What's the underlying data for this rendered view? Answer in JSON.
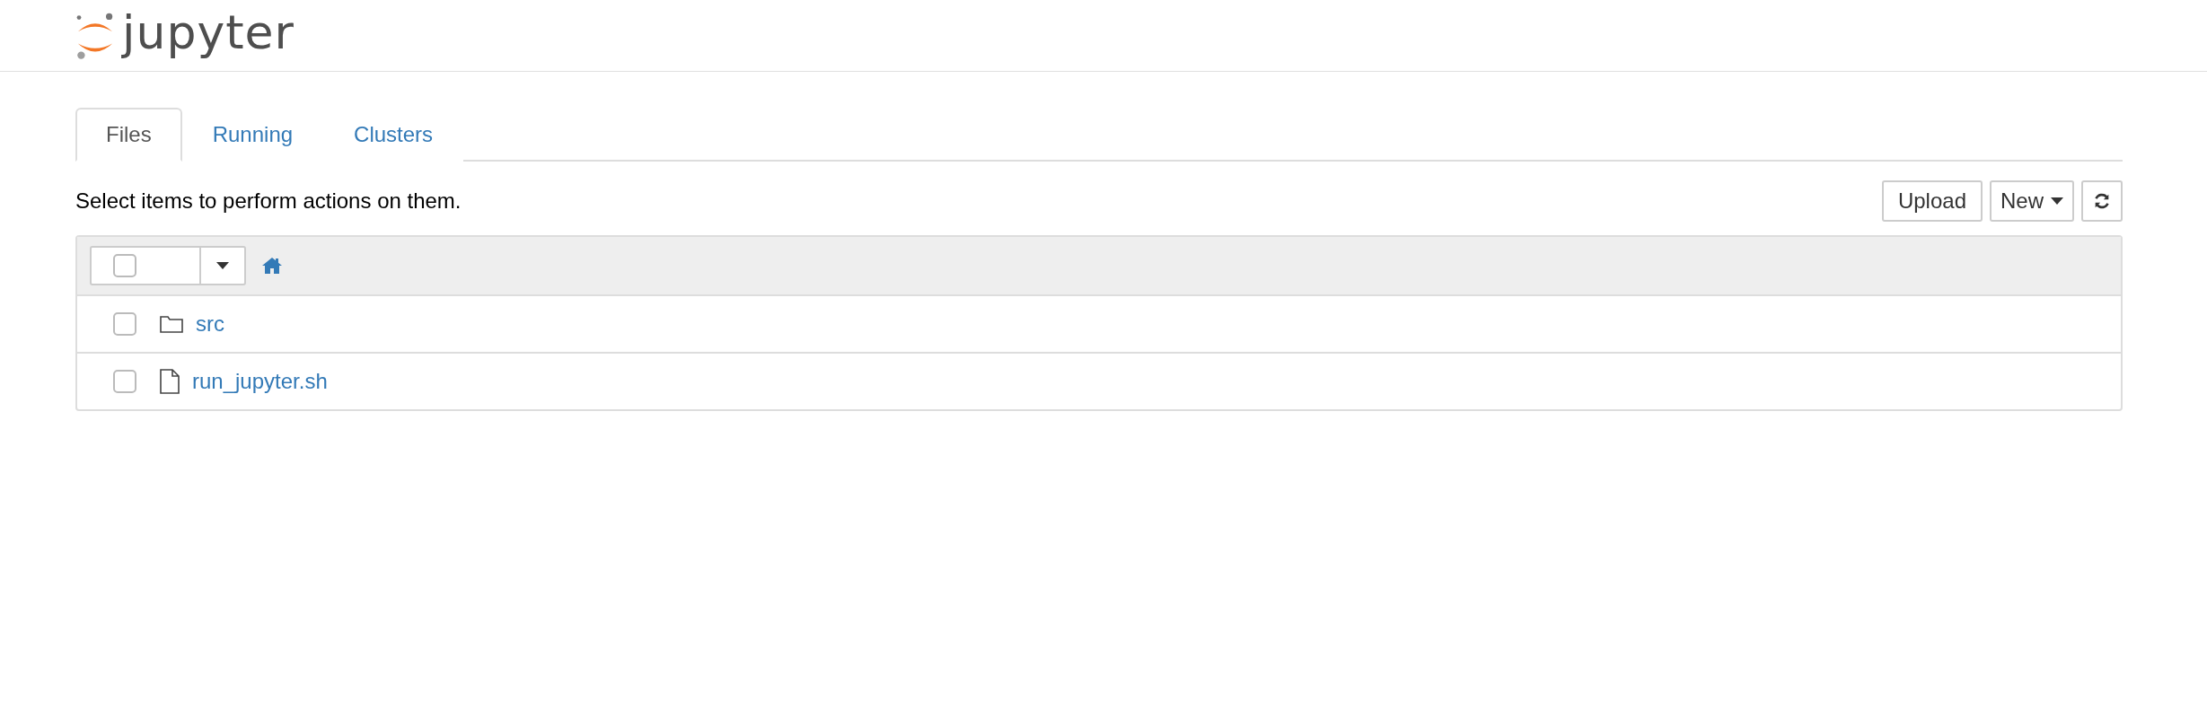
{
  "header": {
    "logo_text": "jupyter"
  },
  "tabs": [
    {
      "label": "Files",
      "selected": true
    },
    {
      "label": "Running",
      "selected": false
    },
    {
      "label": "Clusters",
      "selected": false
    }
  ],
  "toolbar": {
    "hint": "Select items to perform actions on them.",
    "buttons": [
      {
        "kind": "text",
        "label": "Upload"
      },
      {
        "kind": "dropdown",
        "label": "New"
      },
      {
        "kind": "refresh"
      }
    ]
  },
  "list": {
    "select_all": {
      "checked": false
    },
    "items": [
      {
        "kind": "folder",
        "name": "src",
        "checked": false
      },
      {
        "kind": "file",
        "name": "run_jupyter.sh",
        "checked": false
      }
    ]
  }
}
